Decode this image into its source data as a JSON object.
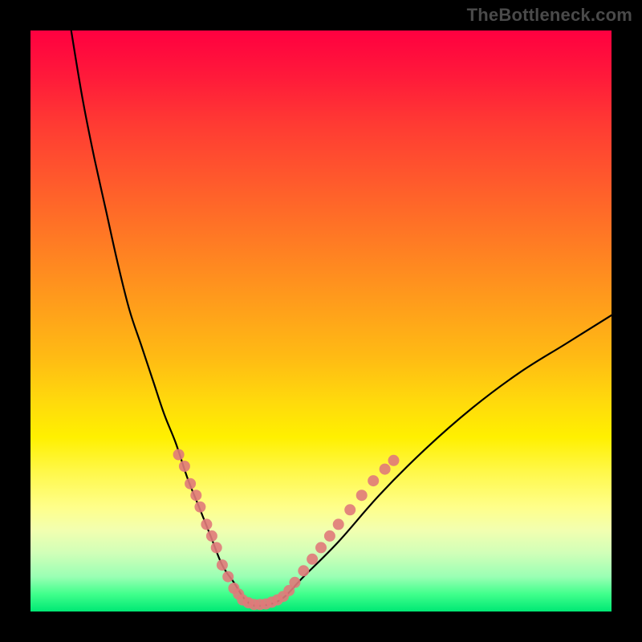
{
  "watermark": "TheBottleneck.com",
  "chart_data": {
    "type": "line",
    "title": "",
    "xlabel": "",
    "ylabel": "",
    "xlim": [
      0,
      100
    ],
    "ylim": [
      0,
      100
    ],
    "series": [
      {
        "name": "bottleneck-curve",
        "x": [
          7,
          9,
          11,
          13,
          15,
          17,
          19,
          21,
          23,
          25,
          27,
          29,
          31,
          33,
          35,
          37,
          39,
          43,
          47,
          53,
          60,
          68,
          76,
          84,
          92,
          100
        ],
        "y": [
          100,
          88,
          78,
          69,
          60,
          52,
          46,
          40,
          34,
          29,
          23,
          18,
          13,
          8,
          5,
          2,
          1,
          2,
          6,
          12,
          20,
          28,
          35,
          41,
          46,
          51
        ]
      }
    ],
    "markers": [
      {
        "name": "highlight-points-left",
        "color": "#e07a7a",
        "points": [
          {
            "x": 25.5,
            "y": 27
          },
          {
            "x": 26.5,
            "y": 25
          },
          {
            "x": 27.5,
            "y": 22
          },
          {
            "x": 28.5,
            "y": 20
          },
          {
            "x": 29.2,
            "y": 18
          },
          {
            "x": 30.3,
            "y": 15
          },
          {
            "x": 31.2,
            "y": 13
          },
          {
            "x": 32.0,
            "y": 11
          },
          {
            "x": 33.0,
            "y": 8
          },
          {
            "x": 34.0,
            "y": 6
          },
          {
            "x": 35.0,
            "y": 4
          },
          {
            "x": 35.8,
            "y": 3
          }
        ]
      },
      {
        "name": "highlight-points-bottom",
        "color": "#e07a7a",
        "points": [
          {
            "x": 36.5,
            "y": 2
          },
          {
            "x": 37.5,
            "y": 1.5
          },
          {
            "x": 38.5,
            "y": 1.2
          },
          {
            "x": 39.5,
            "y": 1.2
          },
          {
            "x": 40.5,
            "y": 1.3
          },
          {
            "x": 41.5,
            "y": 1.6
          },
          {
            "x": 42.5,
            "y": 2
          }
        ]
      },
      {
        "name": "highlight-points-right",
        "color": "#e07a7a",
        "points": [
          {
            "x": 43.5,
            "y": 2.6
          },
          {
            "x": 44.5,
            "y": 3.6
          },
          {
            "x": 45.5,
            "y": 5
          },
          {
            "x": 47.0,
            "y": 7
          },
          {
            "x": 48.5,
            "y": 9
          },
          {
            "x": 50.0,
            "y": 11
          },
          {
            "x": 51.5,
            "y": 13
          },
          {
            "x": 53.0,
            "y": 15
          },
          {
            "x": 55.0,
            "y": 17.5
          },
          {
            "x": 57.0,
            "y": 20
          },
          {
            "x": 59.0,
            "y": 22.5
          },
          {
            "x": 61.0,
            "y": 24.5
          },
          {
            "x": 62.5,
            "y": 26
          }
        ]
      }
    ]
  }
}
